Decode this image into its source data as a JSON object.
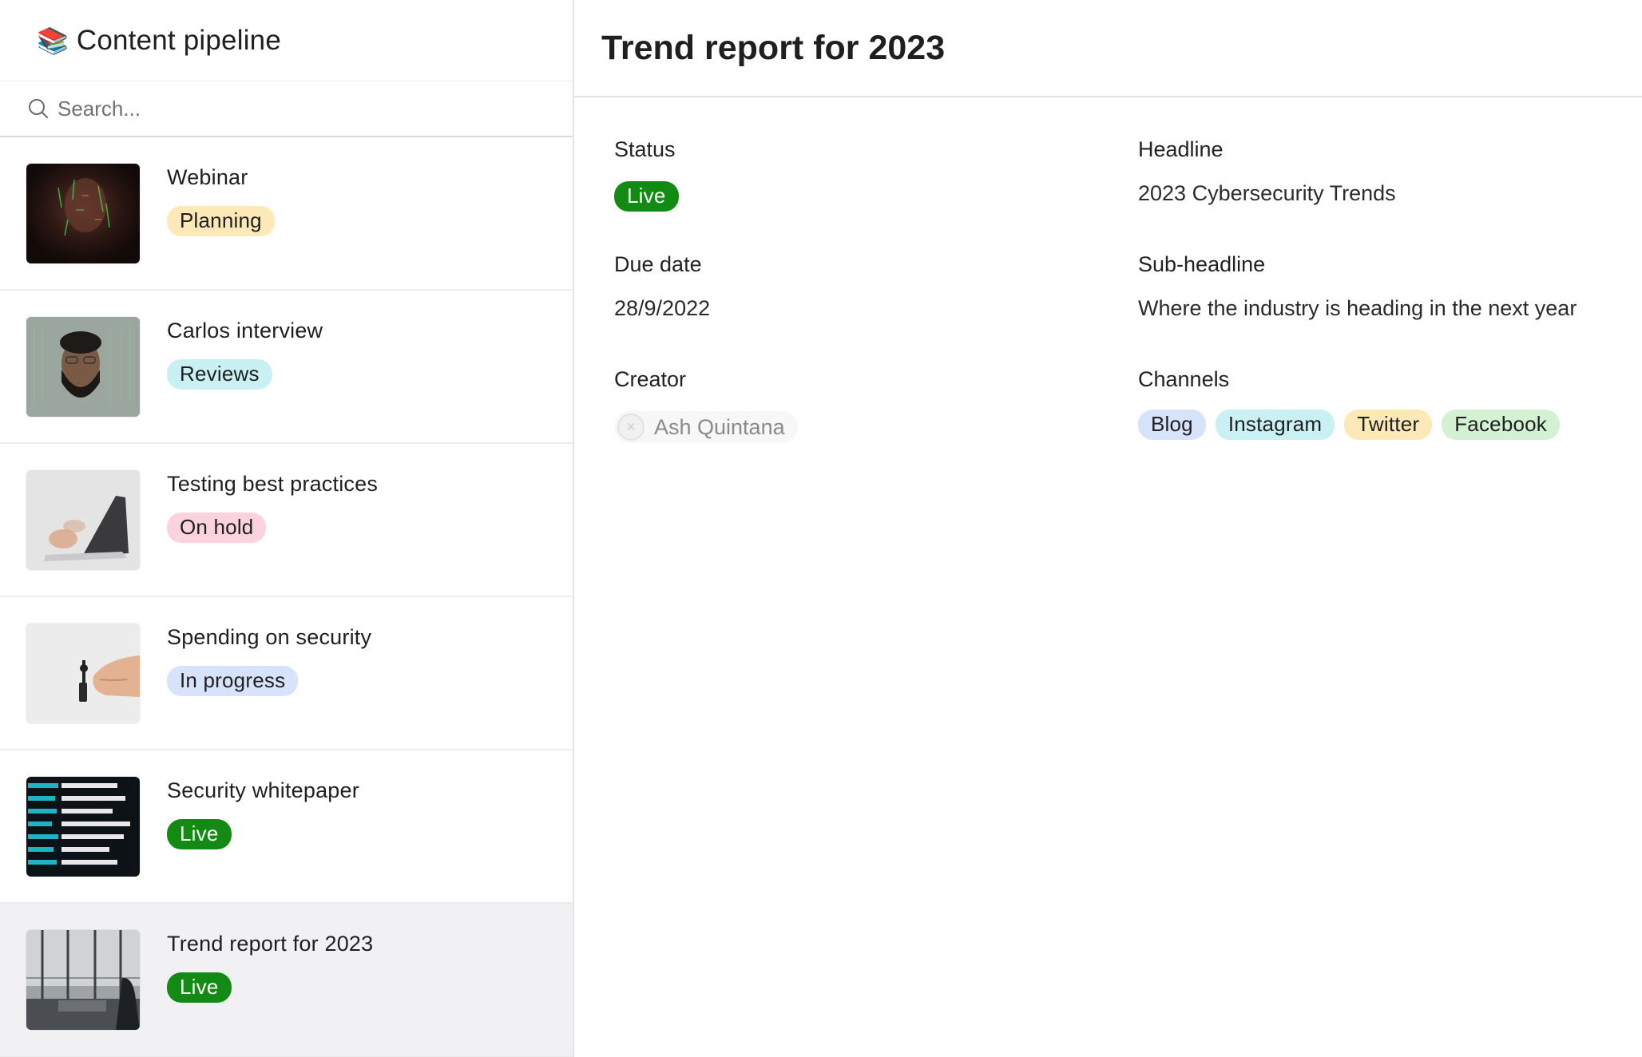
{
  "sidebar": {
    "emoji": "📚",
    "title": "Content pipeline",
    "search_placeholder": "Search...",
    "items": [
      {
        "title": "Webinar",
        "status": "Planning",
        "status_bg": "#fde9b8",
        "status_fg": "#1f1f1f"
      },
      {
        "title": "Carlos interview",
        "status": "Reviews",
        "status_bg": "#c9f0f3",
        "status_fg": "#1f1f1f"
      },
      {
        "title": "Testing best practices",
        "status": "On hold",
        "status_bg": "#fbd3df",
        "status_fg": "#1f1f1f"
      },
      {
        "title": "Spending on security",
        "status": "In progress",
        "status_bg": "#d6e3fb",
        "status_fg": "#1f1f1f"
      },
      {
        "title": "Security whitepaper",
        "status": "Live",
        "status_bg": "#138a13",
        "status_fg": "#ffffff"
      },
      {
        "title": "Trend report for 2023",
        "status": "Live",
        "status_bg": "#138a13",
        "status_fg": "#ffffff"
      }
    ]
  },
  "detail": {
    "title": "Trend report for 2023",
    "status": {
      "label": "Status",
      "value": "Live"
    },
    "headline": {
      "label": "Headline",
      "value": "2023 Cybersecurity Trends"
    },
    "due_date": {
      "label": "Due date",
      "value": "28/9/2022"
    },
    "sub_headline": {
      "label": "Sub-headline",
      "value": "Where the industry is heading in the next year"
    },
    "creator": {
      "label": "Creator",
      "value": "Ash Quintana"
    },
    "channels": {
      "label": "Channels",
      "items": [
        {
          "name": "Blog",
          "bg": "#d6e3fb"
        },
        {
          "name": "Instagram",
          "bg": "#c9f0f3"
        },
        {
          "name": "Twitter",
          "bg": "#fde9b8"
        },
        {
          "name": "Facebook",
          "bg": "#d3f2d3"
        }
      ]
    }
  },
  "colors": {
    "live_green": "#138a13",
    "selected_row": "#f1f1f3"
  }
}
